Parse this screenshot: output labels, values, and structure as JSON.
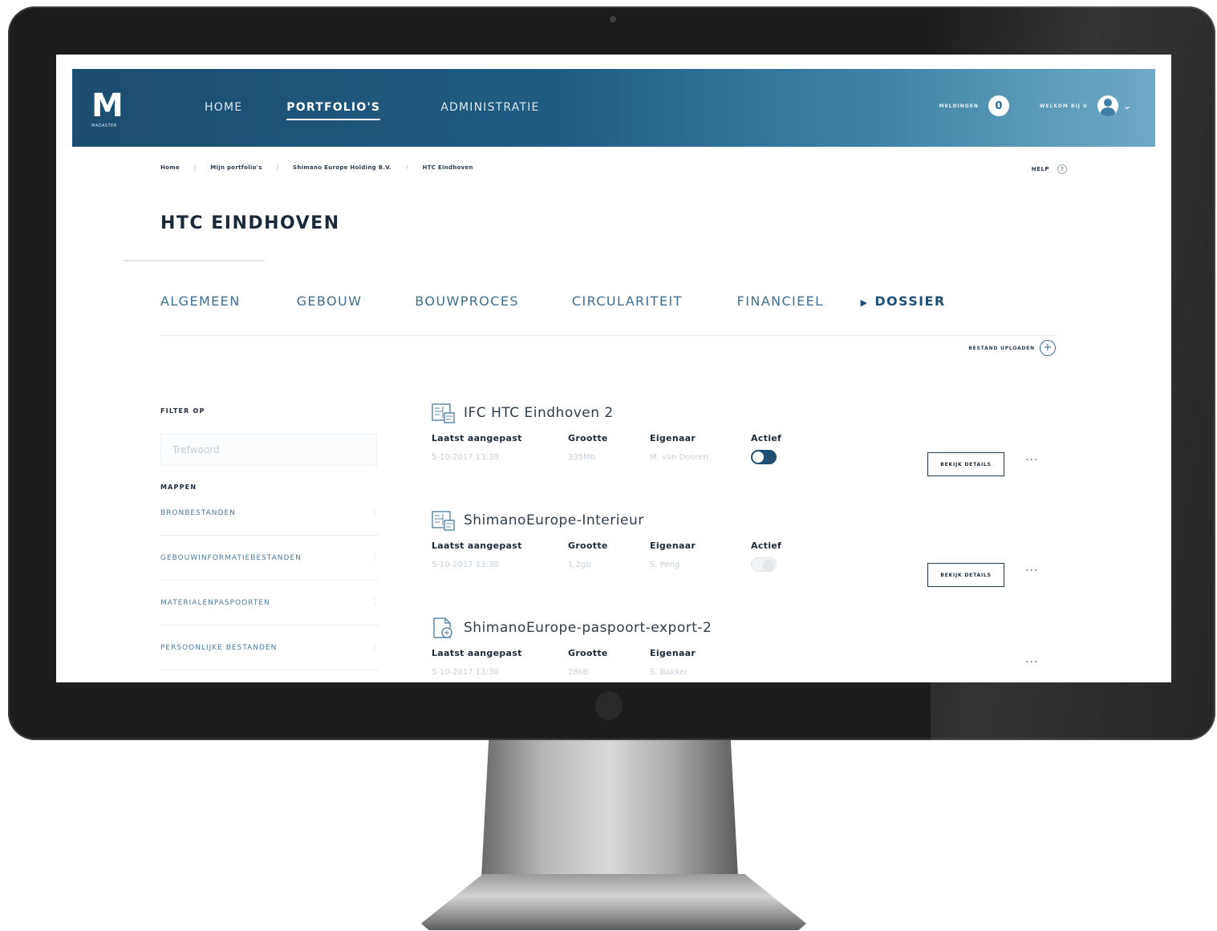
{
  "header": {
    "logo_text": "M",
    "logo_sub": "MADASTER",
    "nav": [
      "HOME",
      "PORTFOLIO'S",
      "ADMINISTRATIE"
    ],
    "notifications_label": "MELDINGEN",
    "notifications_count": "0",
    "user_label": "WELKOM BIJ U",
    "accent_color": "#1f5c84"
  },
  "breadcrumb": [
    "Home",
    "Mijn portfolio's",
    "Shimano Europe Holding B.V.",
    "HTC Eindhoven"
  ],
  "help": {
    "label": "HELP",
    "icon": "question-icon",
    "icon_glyph": "?"
  },
  "page": {
    "title": "HTC EINDHOVEN"
  },
  "tabs": [
    "ALGEMEEN",
    "GEBOUW",
    "BOUWPROCES",
    "CIRCULARITEIT",
    "FINANCIEEL",
    "DOSSIER"
  ],
  "active_tab": "DOSSIER",
  "upload": {
    "label": "BESTAND UPLOADEN",
    "icon": "upload-icon",
    "icon_glyph": "+"
  },
  "sidebar": {
    "filter_heading": "FILTER OP",
    "filter_placeholder": "Trefwoord",
    "folders_heading": "MAPPEN",
    "folders": [
      "BRONBESTANDEN",
      "GEBOUWINFORMATIEBESTANDEN",
      "MATERIALENPASPOORTEN",
      "PERSOONLIJKE BESTANDEN"
    ]
  },
  "column_labels": {
    "modified": "Laatst aangepast",
    "size": "Grootte",
    "owner": "Eigenaar",
    "active": "Actief"
  },
  "files": [
    {
      "name": "IFC HTC Eindhoven 2",
      "modified": "5-10-2017 13:30",
      "size": "335Mb",
      "owner": "M. van Dooren",
      "active": true,
      "details_label": "BEKIJK DETAILS",
      "more_label": "···",
      "icon": "model-file-icon"
    },
    {
      "name": "ShimanoEurope-Interieur",
      "modified": "5-10-2017 13:30",
      "size": "1,2gb",
      "owner": "S. Peng",
      "active": false,
      "details_label": "BEKIJK DETAILS",
      "more_label": "···",
      "icon": "model-file-icon"
    },
    {
      "name": "ShimanoEurope-paspoort-export-2",
      "modified": "5-10-2017 13:30",
      "size": "28kB",
      "owner": "S. Bakker",
      "more_label": "···",
      "icon": "document-file-icon"
    }
  ]
}
